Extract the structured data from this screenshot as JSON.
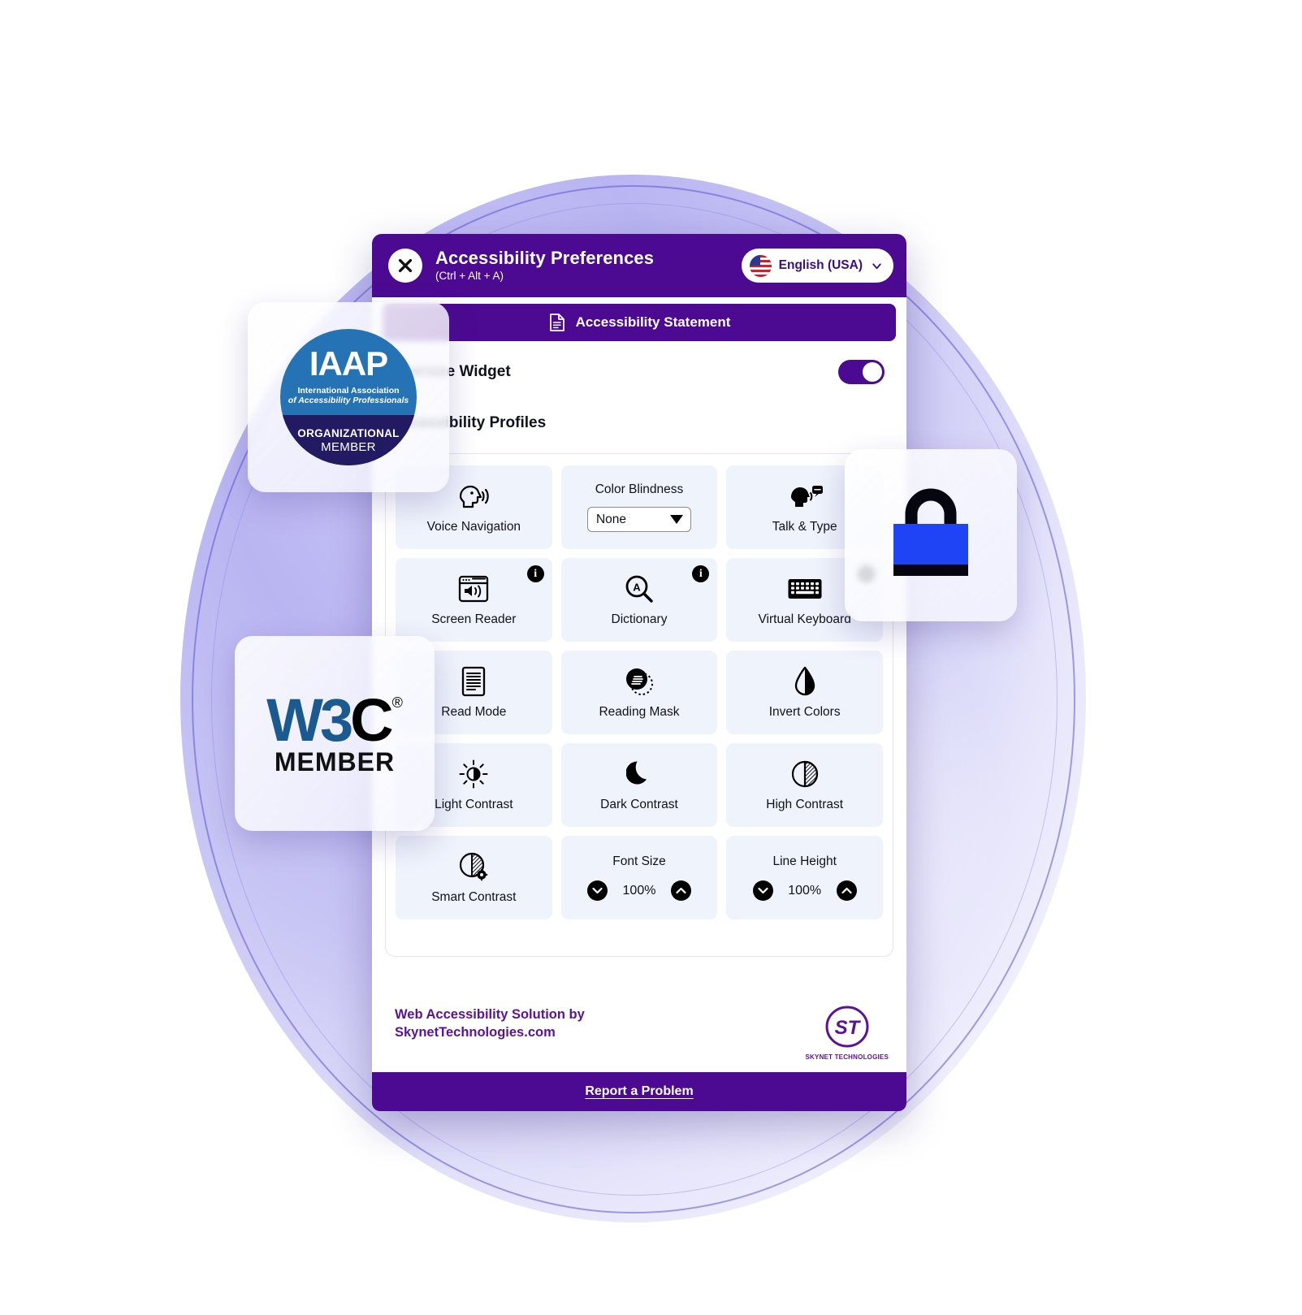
{
  "header": {
    "title": "Accessibility Preferences",
    "shortcut": "(Ctrl + Alt + A)",
    "close_label": "Close",
    "language": "English (USA)"
  },
  "statement": {
    "label": "Accessibility Statement"
  },
  "settings": {
    "oversize_widget_label": "Oversize Widget",
    "oversize_widget_state": "on",
    "profiles_label": "Accessibility Profiles"
  },
  "tiles": [
    {
      "label": "Voice Navigation",
      "icon": "voice-navigation-icon",
      "type": "toggle",
      "info": false
    },
    {
      "label": "Color Blindness",
      "icon": "color-blindness-select",
      "type": "select",
      "value": "None",
      "info": false
    },
    {
      "label": "Talk & Type",
      "icon": "talk-and-type-icon",
      "type": "toggle",
      "info": false
    },
    {
      "label": "Screen Reader",
      "icon": "screen-reader-icon",
      "type": "toggle",
      "info": true
    },
    {
      "label": "Dictionary",
      "icon": "dictionary-icon",
      "type": "toggle",
      "info": true
    },
    {
      "label": "Virtual Keyboard",
      "icon": "virtual-keyboard-icon",
      "type": "toggle",
      "info": true
    },
    {
      "label": "Read Mode",
      "icon": "read-mode-icon",
      "type": "toggle",
      "info": false
    },
    {
      "label": "Reading Mask",
      "icon": "reading-mask-icon",
      "type": "toggle",
      "info": false
    },
    {
      "label": "Invert Colors",
      "icon": "invert-colors-icon",
      "type": "toggle",
      "info": false
    },
    {
      "label": "Light Contrast",
      "icon": "light-contrast-icon",
      "type": "toggle",
      "info": false
    },
    {
      "label": "Dark Contrast",
      "icon": "dark-contrast-icon",
      "type": "toggle",
      "info": false
    },
    {
      "label": "High Contrast",
      "icon": "high-contrast-icon",
      "type": "toggle",
      "info": false
    },
    {
      "label": "Smart Contrast",
      "icon": "smart-contrast-icon",
      "type": "toggle",
      "info": false
    },
    {
      "label": "Font Size",
      "icon": "font-size-stepper",
      "type": "stepper",
      "value": "100%",
      "info": false
    },
    {
      "label": "Line Height",
      "icon": "line-height-stepper",
      "type": "stepper",
      "value": "100%",
      "info": false
    }
  ],
  "info_badge_glyph": "i",
  "footer": {
    "credit_line1": "Web Accessibility Solution by",
    "credit_line2": "SkynetTechnologies.com",
    "logo_mark": "ST",
    "logo_name": "SKYNET TECHNOLOGIES",
    "report_label": "Report a Problem"
  },
  "badges": {
    "iaap": {
      "acronym": "IAAP",
      "line1": "International Association",
      "line2": "of Accessibility Professionals",
      "tier1": "ORGANIZATIONAL",
      "tier2": "MEMBER"
    },
    "w3c": {
      "mark_blue": "W3",
      "mark_black": "C",
      "registered": "®",
      "label": "MEMBER"
    },
    "bag": {
      "name": "shopping-bag-icon"
    }
  },
  "colors": {
    "brand_purple": "#4b0a91",
    "tile_bg": "#eef3fc",
    "iaap_blue": "#2573b5",
    "iaap_navy": "#221b63",
    "bag_blue": "#1f44f5",
    "w3c_blue": "#1a5a8e"
  }
}
